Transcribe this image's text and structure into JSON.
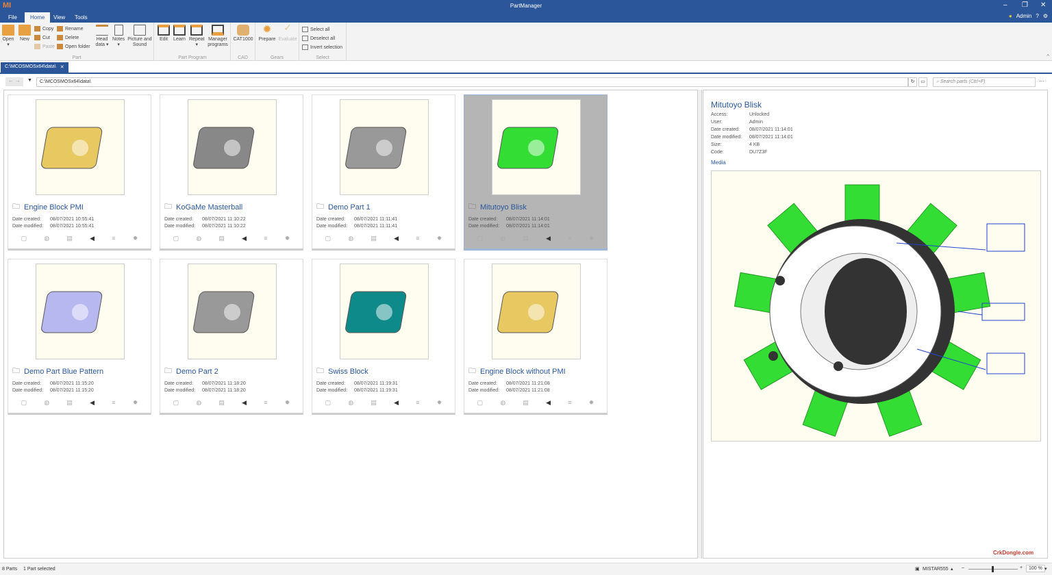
{
  "app": {
    "title": "PartManager",
    "logo": "MI",
    "user": "Admin"
  },
  "menu": {
    "tabs": [
      "File",
      "Home",
      "View",
      "Tools"
    ],
    "active": 1
  },
  "ribbon": {
    "part": {
      "label": "Part",
      "open": "Open",
      "new": "New",
      "copy": "Copy",
      "cut": "Cut",
      "paste": "Paste",
      "rename": "Rename",
      "delete": "Delete",
      "open_folder": "Open folder",
      "head_data": "Head data ▾",
      "notes": "Notes",
      "picture": "Picture and Sound"
    },
    "program": {
      "label": "Part Program",
      "edit": "Edit",
      "learn": "Learn",
      "repeat": "Repeat",
      "manager": "Manager programs"
    },
    "cad": {
      "label": "CAD",
      "cat": "CAT1000"
    },
    "gears": {
      "label": "Gears",
      "prepare": "Prepare",
      "evaluate": "Evaluate"
    },
    "select": {
      "label": "Select",
      "select_all": "Select all",
      "deselect_all": "Deselect all",
      "invert": "Invert selection"
    }
  },
  "doc_tab": "C:\\MCOSMOSx64\\data\\",
  "address": {
    "path": "C:\\MCOSMOSx64\\data\\",
    "search_placeholder": "Search parts (Ctrl+F)"
  },
  "labels": {
    "created": "Date created:",
    "modified": "Date modified:"
  },
  "parts": [
    {
      "name": "Engine Block PMI",
      "created": "08/07/2021 10:55:41",
      "modified": "08/07/2021 10:55:41",
      "color": "#e8c860"
    },
    {
      "name": "KoGaMe Masterball",
      "created": "08/07/2021 11:10:22",
      "modified": "08/07/2021 11:10:22",
      "color": "#888888"
    },
    {
      "name": "Demo Part 1",
      "created": "08/07/2021 11:11:41",
      "modified": "08/07/2021 11:11:41",
      "color": "#999999"
    },
    {
      "name": "Mitutoyo Blisk",
      "created": "08/07/2021 11:14:01",
      "modified": "08/07/2021 11:14:01",
      "color": "#33dd33"
    },
    {
      "name": "Demo Part Blue Pattern",
      "created": "08/07/2021 11:15:20",
      "modified": "08/07/2021 11:15:20",
      "color": "#b8b8f0"
    },
    {
      "name": "Demo Part 2",
      "created": "08/07/2021 11:18:20",
      "modified": "08/07/2021 11:18:20",
      "color": "#999999"
    },
    {
      "name": "Swiss Block",
      "created": "08/07/2021 11:19:31",
      "modified": "08/07/2021 11:19:31",
      "color": "#0f8a8a"
    },
    {
      "name": "Engine Block without PMI",
      "created": "08/07/2021 11:21:08",
      "modified": "08/07/2021 11:21:08",
      "color": "#e8c860"
    }
  ],
  "selected_index": 3,
  "detail": {
    "title": "Mitutoyo Blisk",
    "rows": [
      [
        "Access:",
        "Unlocked"
      ],
      [
        "User:",
        "Admin"
      ],
      [
        "Date created:",
        "08/07/2021 11:14:01"
      ],
      [
        "Date modified:",
        "08/07/2021 11:14:01"
      ],
      [
        "Size:",
        "4 KB"
      ],
      [
        "Code:",
        "DU7Z3F"
      ]
    ],
    "media_label": "Media"
  },
  "watermark": "CrkDongle.com",
  "status": {
    "count": "8 Parts",
    "selection": "1 Part selected",
    "machine": "MISTAR555",
    "zoom": "100 %"
  },
  "colors": {
    "accent": "#2b579a",
    "ribbon_icon": "#c98a3d"
  }
}
